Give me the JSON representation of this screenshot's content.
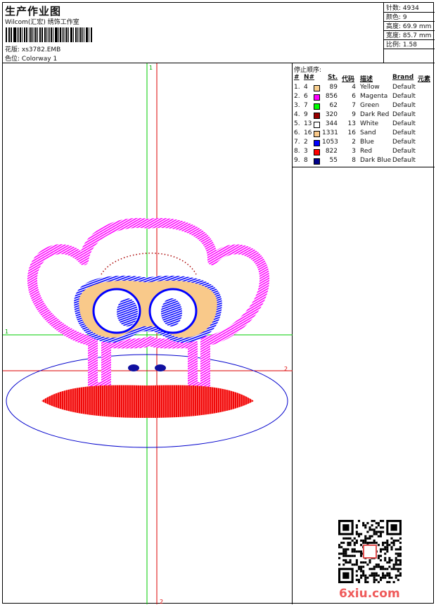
{
  "header": {
    "title": "生产作业图",
    "company": "Wilcom(汇宏) 绣饰工作室",
    "design_label": "花版:",
    "design_file": "xs3782.EMB",
    "colorway_label": "色位:",
    "colorway": "Colorway 1"
  },
  "stats": [
    {
      "label": "针数:",
      "value": "4934"
    },
    {
      "label": "颜色:",
      "value": "9"
    },
    {
      "label": "高度:",
      "value": "69.9 mm"
    },
    {
      "label": "宽度:",
      "value": "85.7 mm"
    },
    {
      "label": "比例:",
      "value": "1.58"
    }
  ],
  "color_table": {
    "title": "停止顺序:",
    "headers": {
      "idx": "#",
      "needle": "N#",
      "st": "St.",
      "code": "代码",
      "desc": "描述",
      "brand": "Brand",
      "elem": "元素"
    },
    "rows": [
      {
        "idx": "1.",
        "needle": "4",
        "color": "#f9cf8e",
        "st": "89",
        "code": "4",
        "desc": "Yellow",
        "brand": "Default"
      },
      {
        "idx": "2.",
        "needle": "6",
        "color": "#ff00ff",
        "st": "856",
        "code": "6",
        "desc": "Magenta",
        "brand": "Default"
      },
      {
        "idx": "3.",
        "needle": "7",
        "color": "#00ff00",
        "st": "62",
        "code": "7",
        "desc": "Green",
        "brand": "Default"
      },
      {
        "idx": "4.",
        "needle": "9",
        "color": "#990000",
        "st": "320",
        "code": "9",
        "desc": "Dark Red",
        "brand": "Default"
      },
      {
        "idx": "5.",
        "needle": "13",
        "color": "#ffffff",
        "st": "344",
        "code": "13",
        "desc": "White",
        "brand": "Default"
      },
      {
        "idx": "6.",
        "needle": "16",
        "color": "#f9c98a",
        "st": "1331",
        "code": "16",
        "desc": "Sand",
        "brand": "Default"
      },
      {
        "idx": "7.",
        "needle": "2",
        "color": "#0000ff",
        "st": "1053",
        "code": "2",
        "desc": "Blue",
        "brand": "Default"
      },
      {
        "idx": "8.",
        "needle": "3",
        "color": "#ff0000",
        "st": "822",
        "code": "3",
        "desc": "Red",
        "brand": "Default"
      },
      {
        "idx": "9.",
        "needle": "8",
        "color": "#00008b",
        "st": "55",
        "code": "8",
        "desc": "Dark Blue",
        "brand": "Default"
      }
    ]
  },
  "guides": {
    "top_label": "1",
    "left_label": "1",
    "right_label": "2",
    "bottom_label": "2"
  },
  "watermark": "6xiu.com",
  "colors": {
    "magenta": "#ff00ff",
    "sand": "#f9c98a",
    "blue": "#0000ff",
    "dark_blue": "#1010a0",
    "red": "#ff0000",
    "dark_red": "#aa0000",
    "guide_green": "#00cc00",
    "guide_red": "#dd0000",
    "outline_blue": "#0000cc"
  }
}
